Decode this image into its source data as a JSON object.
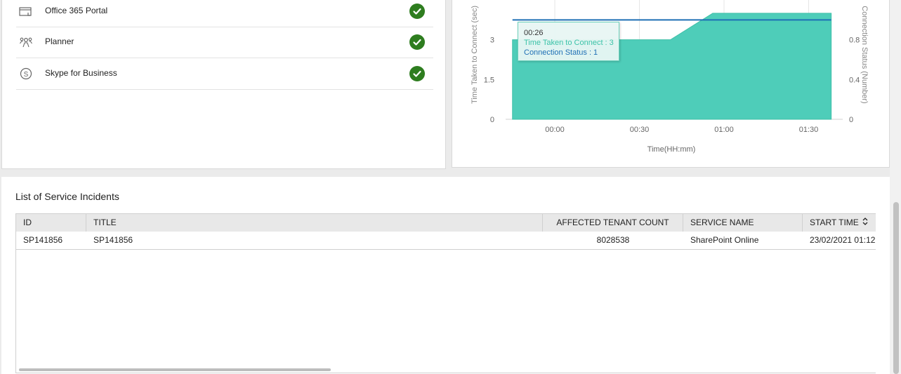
{
  "services": [
    {
      "name": "Office 365 Portal",
      "icon": "portal-icon",
      "status": "ok"
    },
    {
      "name": "Planner",
      "icon": "planner-icon",
      "status": "ok"
    },
    {
      "name": "Skype for Business",
      "icon": "skype-icon",
      "status": "ok"
    }
  ],
  "colors": {
    "status_ok": "#2e7d1f",
    "area": "#4ecdb9",
    "line": "#1f6fb5"
  },
  "chart_data": {
    "type": "area",
    "xlabel": "Time(HH:mm)",
    "ylabel": "Time Taken to Connect (sec)",
    "y2label": "Connection Status (Number)",
    "x_ticks": [
      "00:00",
      "00:30",
      "01:00",
      "01:30"
    ],
    "y_ticks": [
      "0",
      "1.5",
      "3"
    ],
    "y2_ticks": [
      "0",
      "0.4",
      "0.8"
    ],
    "ylim": [
      0,
      4.5
    ],
    "y2lim": [
      0,
      1.2
    ],
    "grid": true,
    "series": [
      {
        "name": "Time Taken to Connect",
        "axis": "left",
        "type": "area",
        "x": [
          "-00:15",
          "00:41",
          "00:56",
          "01:38"
        ],
        "values": [
          3,
          3,
          4,
          4
        ]
      },
      {
        "name": "Connection Status",
        "axis": "right",
        "type": "line",
        "x": [
          "-00:15",
          "01:38"
        ],
        "values": [
          1,
          1
        ]
      }
    ],
    "tooltip": {
      "time": "00:26",
      "line1": "Time Taken to Connect : 3",
      "line2": "Connection Status : 1"
    }
  },
  "incidents": {
    "title": "List of Service Incidents",
    "columns": [
      "ID",
      "TITLE",
      "AFFECTED TENANT COUNT",
      "SERVICE NAME",
      "START TIME"
    ],
    "sort_icon": "sort-icon",
    "rows": [
      [
        "SP141856",
        "SP141856",
        "8028538",
        "SharePoint Online",
        "23/02/2021 01:12"
      ]
    ]
  }
}
